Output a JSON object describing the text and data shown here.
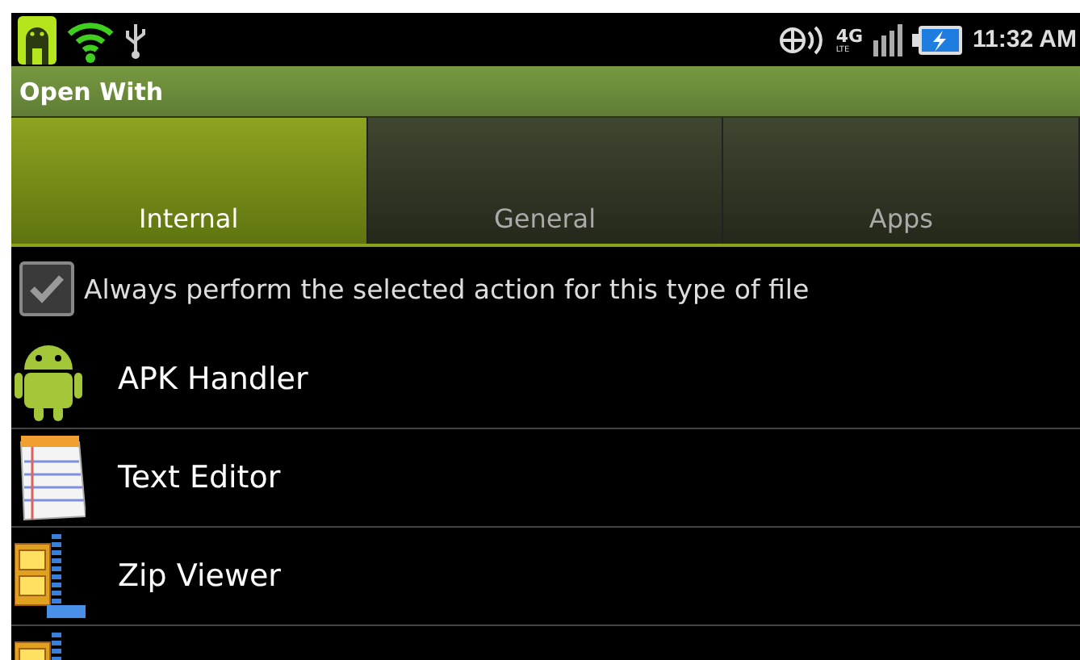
{
  "status_bar": {
    "network": "4G",
    "network_sub": "LTE",
    "time": "11:32 AM"
  },
  "window": {
    "title": "Open With"
  },
  "tabs": [
    {
      "label": "Internal",
      "selected": true
    },
    {
      "label": "General",
      "selected": false
    },
    {
      "label": "Apps",
      "selected": false
    }
  ],
  "always_option": {
    "label": "Always perform the selected action for this type of file",
    "checked": true
  },
  "apps": [
    {
      "kind": "android",
      "label": "APK Handler"
    },
    {
      "kind": "notepad",
      "label": "Text Editor"
    },
    {
      "kind": "archive",
      "label": "Zip Viewer"
    },
    {
      "kind": "archive"
    }
  ]
}
